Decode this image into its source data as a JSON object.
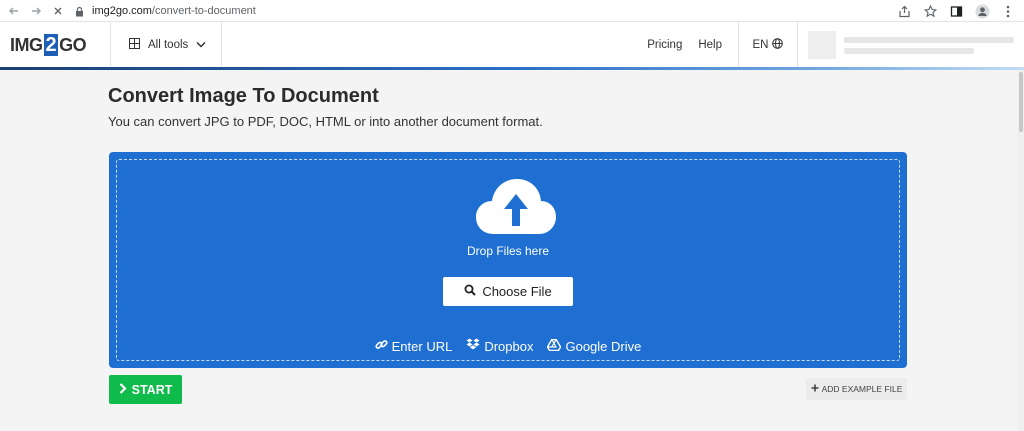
{
  "browser": {
    "url_host": "img2go.com",
    "url_path": "/convert-to-document"
  },
  "header": {
    "logo_left": "IMG",
    "logo_mid": "2",
    "logo_right": "GO",
    "all_tools": "All tools",
    "pricing": "Pricing",
    "help": "Help",
    "language": "EN"
  },
  "main": {
    "title": "Convert Image To Document",
    "subtitle": "You can convert JPG to PDF, DOC, HTML or into another document format."
  },
  "dropzone": {
    "drop_text": "Drop Files here",
    "choose_file": "Choose File",
    "enter_url": "Enter URL",
    "dropbox": "Dropbox",
    "google_drive": "Google Drive"
  },
  "actions": {
    "start": "START",
    "add_example": "ADD EXAMPLE FILE"
  },
  "colors": {
    "accent_blue": "#1f6fd2",
    "start_green": "#0fbc4b",
    "logo_blue": "#1d5fb5"
  }
}
